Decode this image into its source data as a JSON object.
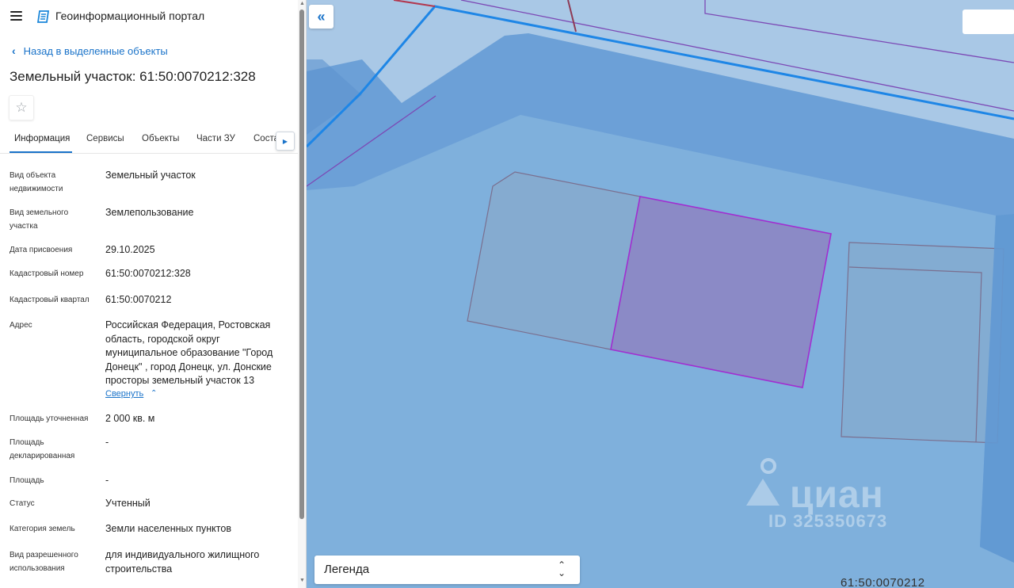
{
  "header": {
    "app_title": "Геоинформационный портал",
    "menu_icon": "hamburger-icon",
    "logo_icon": "portal-logo-icon"
  },
  "nav": {
    "back_label": "Назад в выделенные объекты"
  },
  "object": {
    "title": "Земельный участок: 61:50:0070212:328"
  },
  "tabs": [
    {
      "label": "Информация",
      "active": true
    },
    {
      "label": "Сервисы"
    },
    {
      "label": "Объекты"
    },
    {
      "label": "Части ЗУ"
    },
    {
      "label": "Соста"
    }
  ],
  "info": {
    "rows": [
      {
        "label": "Вид объекта недвижимости",
        "value": "Земельный участок"
      },
      {
        "label": "Вид земельного участка",
        "value": "Землепользование"
      },
      {
        "label": "Дата присвоения",
        "value": "29.10.2025"
      },
      {
        "label": "Кадастровый номер",
        "value": "61:50:0070212:328"
      },
      {
        "label": "Кадастровый квартал",
        "value": "61:50:0070212"
      },
      {
        "label": "Адрес",
        "value": "Российская Федерация, Ростовская область, городской округ муниципальное образование \"Город Донецк\" , город Донецк, ул. Донские просторы земельный участок 13"
      },
      {
        "label": "Площадь уточненная",
        "value": "2 000 кв. м"
      },
      {
        "label": "Площадь декларированная",
        "value": "-"
      },
      {
        "label": "Площадь",
        "value": "-"
      },
      {
        "label": "Статус",
        "value": "Учтенный"
      },
      {
        "label": "Категория земель",
        "value": "Земли населенных пунктов"
      },
      {
        "label": "Вид разрешенного использования",
        "value": "для индивидуального жилищного строительства"
      }
    ],
    "collapse_label": "Свернуть"
  },
  "map": {
    "collapse_icon": "double-chevron-left-icon",
    "legend_label": "Легенда",
    "cadastral_label": "61:50:0070212",
    "watermark_brand": "циан",
    "watermark_id": "ID 325350673",
    "colors": {
      "base": "#a9c8e6",
      "zone_dark": "#6299d3",
      "zone_light": "#7fb0dc",
      "selected_parcel": "#9b3dcc",
      "road_line": "#1e86e6"
    }
  }
}
